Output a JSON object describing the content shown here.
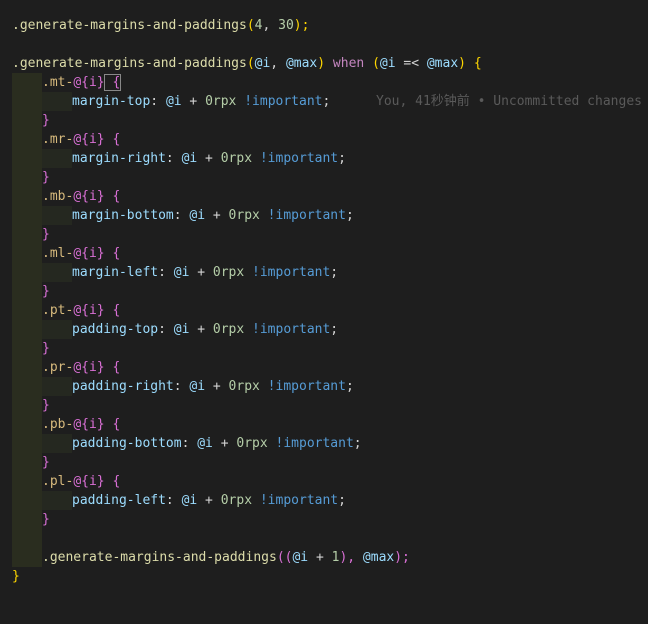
{
  "editor": {
    "lines": {
      "l1": {
        "fn": ".generate-margins-and-paddings",
        "open": "(",
        "arg1": "4",
        "sep": ", ",
        "arg2": "30",
        "close": ");"
      },
      "l2": {
        "fn": ".generate-margins-and-paddings",
        "open": "(",
        "v1": "@i",
        "sep": ", ",
        "v2": "@max",
        "close": ")",
        "kw": " when ",
        "open2": "(",
        "v3": "@i",
        "op": " =< ",
        "v4": "@max",
        "close2": ")",
        "brace": " {"
      },
      "rules": [
        {
          "sel": ".mt-",
          "interp": "@{i}",
          "brace": " {",
          "prop": "margin-top",
          "colon": ": ",
          "v": "@i",
          "plus": " + ",
          "num": "0rpx",
          "imp": " !important",
          "semi": ";"
        },
        {
          "sel": ".mr-",
          "interp": "@{i}",
          "brace": " {",
          "prop": "margin-right",
          "colon": ": ",
          "v": "@i",
          "plus": " + ",
          "num": "0rpx",
          "imp": " !important",
          "semi": ";"
        },
        {
          "sel": ".mb-",
          "interp": "@{i}",
          "brace": " {",
          "prop": "margin-bottom",
          "colon": ": ",
          "v": "@i",
          "plus": " + ",
          "num": "0rpx",
          "imp": " !important",
          "semi": ";"
        },
        {
          "sel": ".ml-",
          "interp": "@{i}",
          "brace": " {",
          "prop": "margin-left",
          "colon": ": ",
          "v": "@i",
          "plus": " + ",
          "num": "0rpx",
          "imp": " !important",
          "semi": ";"
        },
        {
          "sel": ".pt-",
          "interp": "@{i}",
          "brace": " {",
          "prop": "padding-top",
          "colon": ": ",
          "v": "@i",
          "plus": " + ",
          "num": "0rpx",
          "imp": " !important",
          "semi": ";"
        },
        {
          "sel": ".pr-",
          "interp": "@{i}",
          "brace": " {",
          "prop": "padding-right",
          "colon": ": ",
          "v": "@i",
          "plus": " + ",
          "num": "0rpx",
          "imp": " !important",
          "semi": ";"
        },
        {
          "sel": ".pb-",
          "interp": "@{i}",
          "brace": " {",
          "prop": "padding-bottom",
          "colon": ": ",
          "v": "@i",
          "plus": " + ",
          "num": "0rpx",
          "imp": " !important",
          "semi": ";"
        },
        {
          "sel": ".pl-",
          "interp": "@{i}",
          "brace": " {",
          "prop": "padding-left",
          "colon": ": ",
          "v": "@i",
          "plus": " + ",
          "num": "0rpx",
          "imp": " !important",
          "semi": ";"
        }
      ],
      "close_brace": "}",
      "recurse": {
        "fn": ".generate-margins-and-paddings",
        "open": "((",
        "v1": "@i",
        "plus": " + ",
        "num": "1",
        "mid": "), ",
        "v2": "@max",
        "close": ");"
      },
      "final_brace": "}"
    },
    "blame": "You, 41秒钟前 • Uncommitted changes"
  },
  "colors": {
    "background": "#1e1e1e",
    "function": "#dcdcaa",
    "number": "#b5cea8",
    "variable": "#9cdcfe",
    "keyword": "#c586c0",
    "selector": "#d7ba7d",
    "important": "#569cd6",
    "brace_level1": "#ffd700",
    "brace_level2": "#da70d6",
    "blame": "#5a5a5a"
  }
}
